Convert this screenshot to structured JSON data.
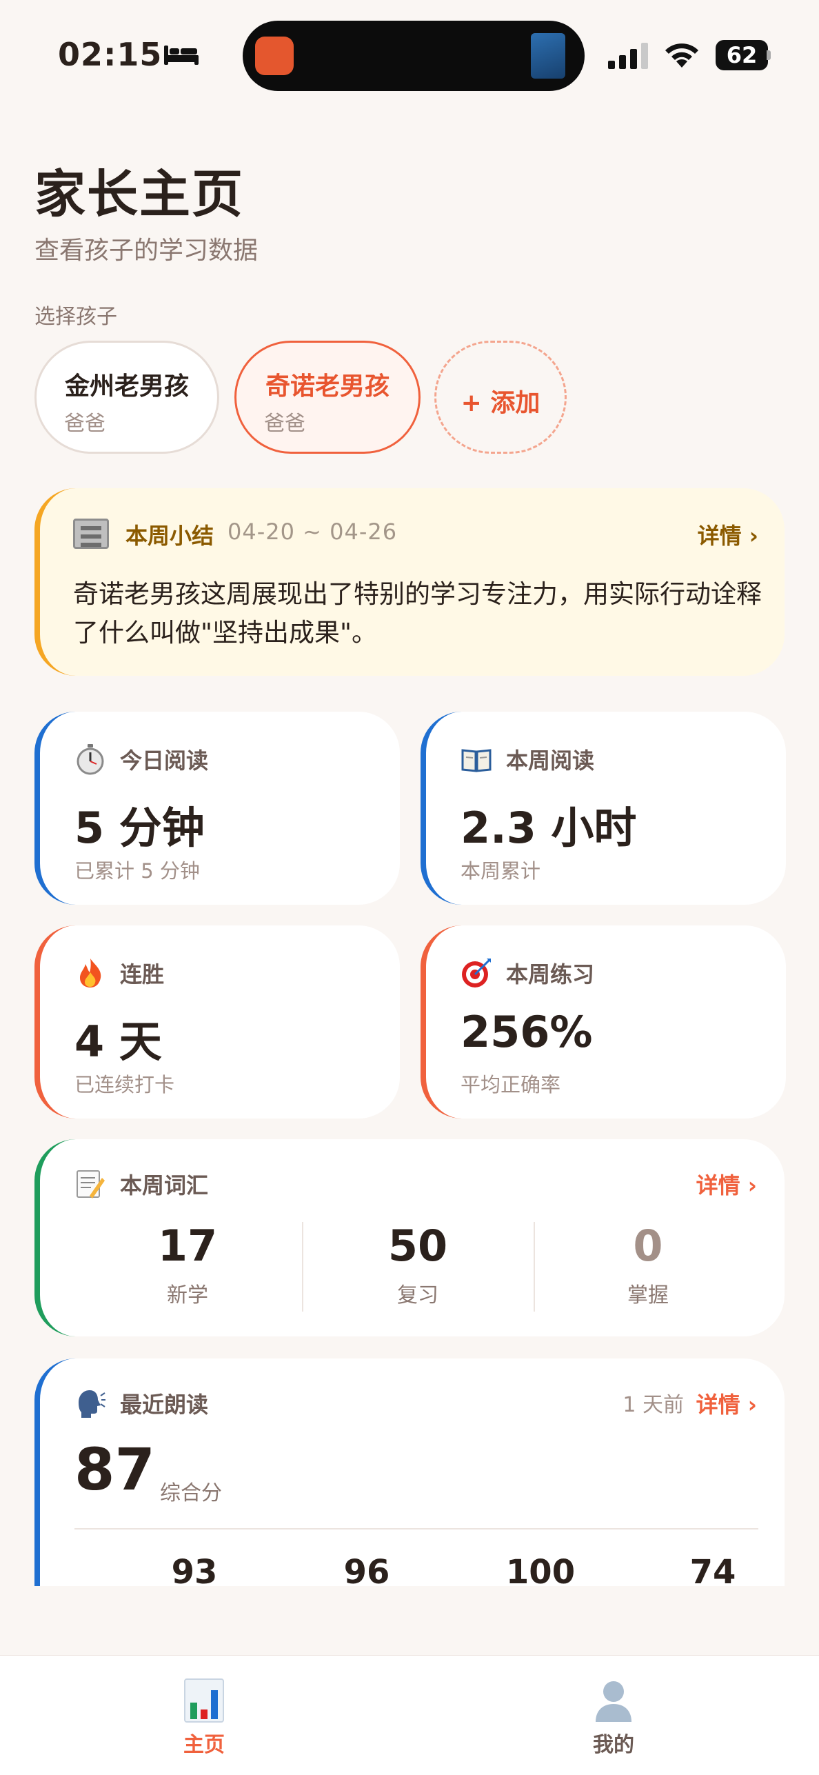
{
  "status_bar": {
    "time": "02:15",
    "battery": "62"
  },
  "header": {
    "title": "家长主页",
    "subtitle": "查看孩子的学习数据"
  },
  "children_section": {
    "label": "选择孩子",
    "children": [
      {
        "name": "金州老男孩",
        "role": "爸爸",
        "selected": false
      },
      {
        "name": "奇诺老男孩",
        "role": "爸爸",
        "selected": true
      }
    ],
    "add_label": "+ 添加"
  },
  "weekly_summary": {
    "title": "本周小结",
    "range": "04-20 ~ 04-26",
    "detail_label": "详情 ›",
    "text": "奇诺老男孩这周展现出了特别的学习专注力，用实际行动诠释了什么叫做\"坚持出成果\"。",
    "accent": "#f5a623"
  },
  "stats": {
    "today_reading": {
      "label": "今日阅读",
      "value": "5 分钟",
      "sub": "已累计 5 分钟",
      "icon": "stopwatch-icon"
    },
    "week_reading": {
      "label": "本周阅读",
      "value": "2.3 小时",
      "sub": "本周累计",
      "icon": "book-icon"
    },
    "streak": {
      "label": "连胜",
      "value": "4 天",
      "sub": "已连续打卡",
      "icon": "fire-icon"
    },
    "practice": {
      "label": "本周练习",
      "value": "256%",
      "sub": "平均正确率",
      "icon": "target-icon"
    }
  },
  "vocab": {
    "label": "本周词汇",
    "detail_label": "详情 ›",
    "items": [
      {
        "value": "17",
        "label": "新学",
        "color": "#2b211c"
      },
      {
        "value": "50",
        "label": "复习",
        "color": "#2b211c"
      },
      {
        "value": "0",
        "label": "掌握",
        "color": "#a39088"
      }
    ]
  },
  "reading": {
    "label": "最近朗读",
    "ago": "1 天前",
    "detail_label": "详情 ›",
    "score": "87",
    "score_label": "综合分",
    "sub_scores": [
      "93",
      "96",
      "100",
      "74"
    ]
  },
  "tab_bar": {
    "home_label": "主页",
    "me_label": "我的",
    "active_color": "#f0613d"
  }
}
